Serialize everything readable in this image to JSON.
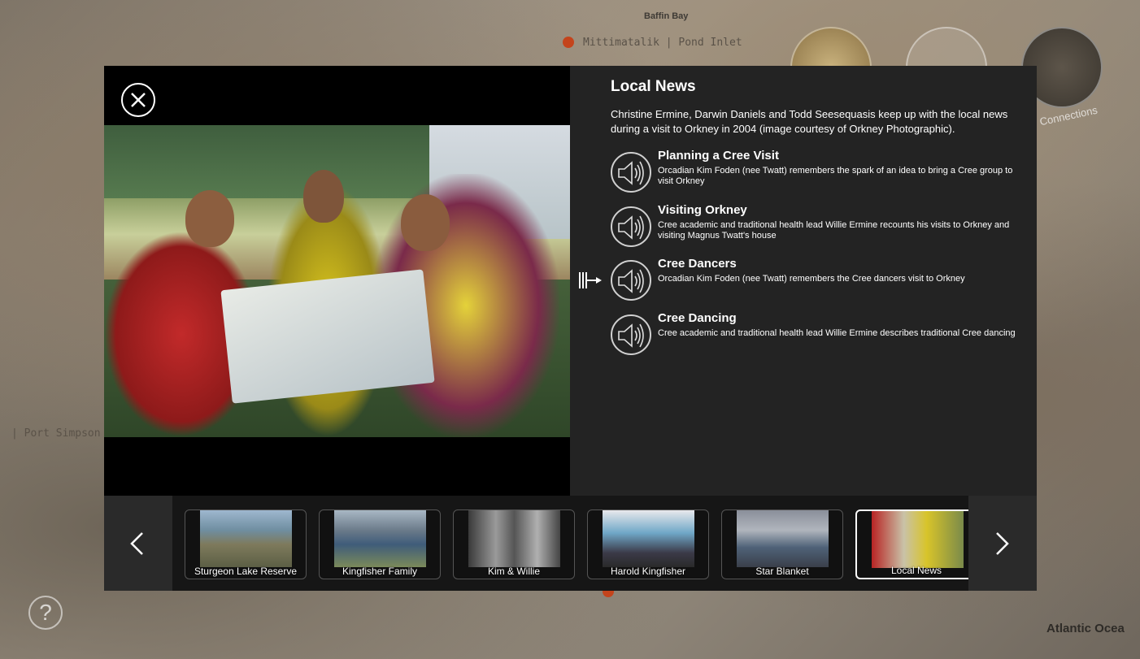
{
  "map": {
    "baffin_bay": "Baffin Bay",
    "north_label": "Mittimatalik | Pond Inlet",
    "west_label": "| Port Simpson",
    "atlantic_label": "Atlantic Ocea",
    "connections_label": "Connections",
    "help_symbol": "?"
  },
  "modal": {
    "close_icon": "close-icon",
    "title": "Local News",
    "description": "Christine Ermine, Darwin Daniels and Todd Seesequasis keep up with the local news during a visit to Orkney in 2004 (image courtesy of Orkney Photographic).",
    "audio_items": [
      {
        "title": "Planning a Cree Visit",
        "description": "Orcadian Kim Foden (nee Twatt) remembers the spark of an idea to bring a Cree group to visit Orkney",
        "icon": "speaker-icon"
      },
      {
        "title": "Visiting Orkney",
        "description": "Cree academic and traditional health lead Willie Ermine recounts his visits to Orkney and visiting Magnus Twatt's house",
        "icon": "speaker-icon"
      },
      {
        "title": "Cree Dancers",
        "description": "Orcadian Kim Foden (nee Twatt) remembers the Cree dancers visit to Orkney",
        "icon": "speaker-icon",
        "playing": true
      },
      {
        "title": "Cree Dancing",
        "description": "Cree academic and traditional health lead Willie Ermine describes traditional Cree dancing",
        "icon": "speaker-icon"
      }
    ]
  },
  "thumbnails": [
    {
      "label": "Sturgeon Lake Reserve"
    },
    {
      "label": "Kingfisher Family"
    },
    {
      "label": "Kim & Willie"
    },
    {
      "label": "Harold Kingfisher"
    },
    {
      "label": "Star Blanket"
    },
    {
      "label": "Local News",
      "selected": true
    }
  ],
  "colors": {
    "modal_bg": "#232323",
    "strip_bg": "#161616",
    "accent": "#ffffff"
  }
}
